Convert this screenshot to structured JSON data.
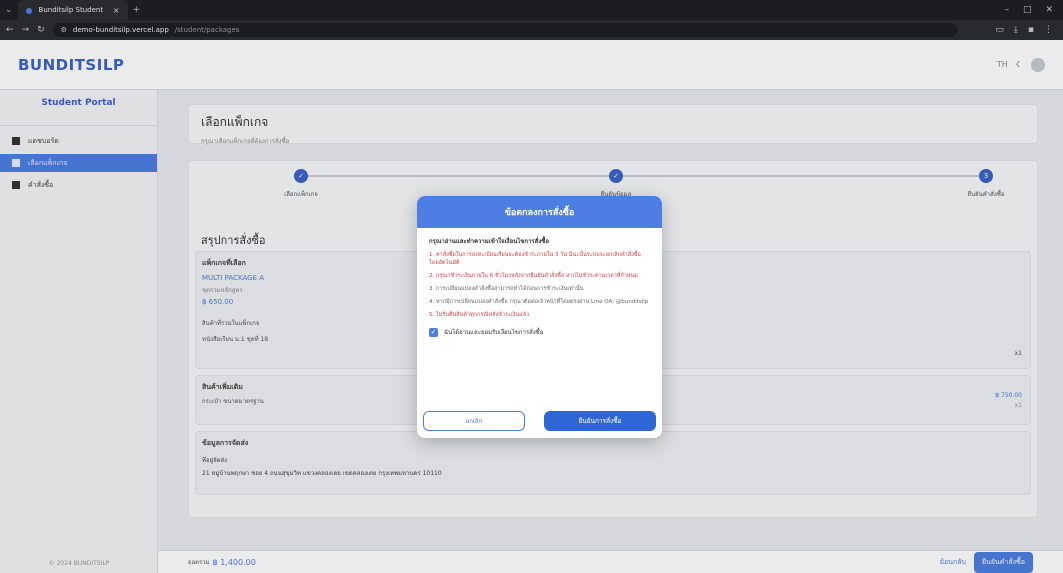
{
  "browser": {
    "tab_title": "Bunditsilp Student",
    "tab_close": "×",
    "new_tab": "+",
    "url_host": "demo-bunditsilp.vercel.app",
    "url_path": "/student/packages",
    "window_min": "–",
    "window_max": "□",
    "window_close": "✕"
  },
  "header": {
    "brand": "BUNDITSILP",
    "lang": "TH"
  },
  "sidebar": {
    "portal_title": "Student Portal",
    "items": [
      {
        "label": "แดชบอร์ด"
      },
      {
        "label": "เลือกแพ็กเกจ"
      },
      {
        "label": "คำสั่งซื้อ"
      }
    ],
    "copyright": "© 2024 BUNDITSILP"
  },
  "page": {
    "title": "เลือกแพ็กเกจ",
    "subtitle": "กรุณาเลือกแพ็กเกจที่ต้องการสั่งซื้อ",
    "steps": [
      {
        "label": "เลือกแพ็กเกจ",
        "mark": "✓"
      },
      {
        "label": "ยืนยันข้อมูล",
        "mark": "✓"
      },
      {
        "label": "ยืนยันคำสั่งซื้อ",
        "mark": "3"
      }
    ],
    "summary_title": "สรุปการสั่งซื้อ",
    "selected_label": "แพ็กเกจที่เลือก",
    "package_name": "MULTI PACKAGE A",
    "package_desc": "ชุดรวมหลักสูตร",
    "package_price": "฿ 650.00",
    "included_label": "สินค้าที่รวมในแพ็กเกจ",
    "included_item": "หนังสือเรียน ม.1 ชุดที่ 18",
    "included_qty": "x1",
    "extra_label": "สินค้าเพิ่มเติม",
    "extra_item": "กระเป๋า ขนาดมาตรฐาน",
    "extra_price": "฿ 750.00",
    "extra_qty": "x1",
    "shipping_label": "ข้อมูลการจัดส่ง",
    "address_label": "ที่อยู่จัดส่ง",
    "address": "21 หมู่บ้านพฤกษา ซอย 4 ถนนสุขุมวิท แขวงคลองเตย เขตคลองเตย กรุงเทพมหานคร 10110",
    "total_label": "ยอดรวม",
    "total_value": "฿ 1,400.00",
    "back_label": "ย้อนกลับ",
    "next_label": "ยืนยันคำสั่งซื้อ"
  },
  "modal": {
    "title": "ข้อตกลงการสั่งซื้อ",
    "intro": "กรุณาอ่านและทำความเข้าใจเงื่อนไขการสั่งซื้อ",
    "terms": [
      {
        "text": "1. ค่าสั่งซื้อในการลงทะเบียนเรียนจะต้องชำระภายใน 3 วัน มิฉะนั้นระบบจะยกเลิกคำสั่งซื้อโดยอัตโนมัติ",
        "tone": "red"
      },
      {
        "text": "2. กรุณาชำระเงินภายใน 6 ชั่วโมงหลังจากยืนยันคำสั่งซื้อ หากไม่ชำระตามเวลาที่กำหนด",
        "tone": "red"
      },
      {
        "text": "3. การเปลี่ยนแปลงคำสั่งซื้อสามารถทำได้ก่อนการชำระเงินเท่านั้น",
        "tone": "gray"
      },
      {
        "text": "4. หากมีการเปลี่ยนแปลงคำสั่งซื้อ กรุณาติดต่อเจ้าหน้าที่โดยตรงผ่าน Line OA: @bunditsilp",
        "tone": "gray"
      },
      {
        "text": "5. ไม่รับคืนสินค้าทุกกรณีหลังชำระเงินแล้ว",
        "tone": "red"
      }
    ],
    "agree_label": "ฉันได้อ่านและยอมรับเงื่อนไขการสั่งซื้อ",
    "agree_mark": "✓",
    "cancel_label": "ยกเลิก",
    "confirm_label": "ยืนยันการสั่งซื้อ"
  },
  "colors": {
    "accent": "#4d7ee3",
    "brand": "#3c63c9",
    "warning_text": "#d64141"
  }
}
